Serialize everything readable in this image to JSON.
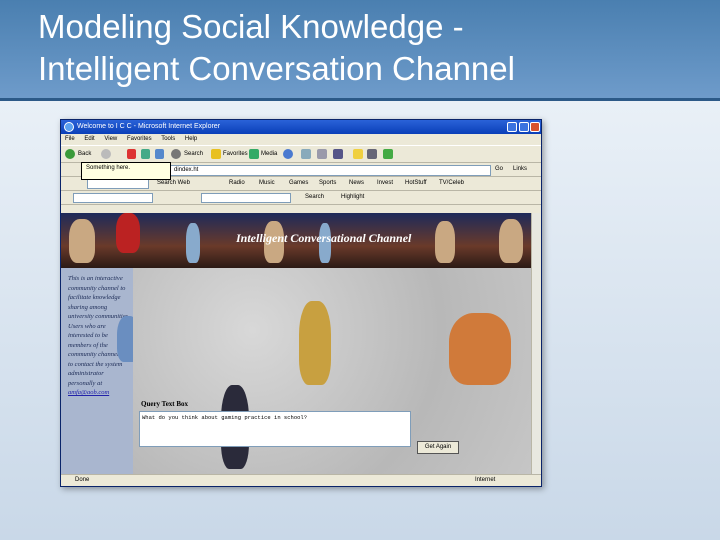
{
  "slide": {
    "title_line1": "Modeling Social Knowledge -",
    "title_line2": "Intelligent Conversation Channel"
  },
  "browser": {
    "window_title": "Welcome to I C C - Microsoft Internet Explorer",
    "menu": [
      "File",
      "Edit",
      "View",
      "Favorites",
      "Tools",
      "Help"
    ],
    "toolbar": {
      "back_label": "Back",
      "search_label": "Search",
      "favorites_label": "Favorites",
      "media_label": "Media"
    },
    "tooltip": "Something here.",
    "address_value": "dindex.ht",
    "go_label": "Go",
    "links_label": "Links",
    "links_bar_items": [
      "Radio",
      "Music",
      "Games",
      "Sports",
      "News",
      "Invest",
      "HotStuff",
      "TV/Celeb"
    ],
    "search_web_label": "Search Web",
    "search_label2": "Search",
    "highlight_label": "Highlight",
    "status_left": "Done",
    "status_right": "Internet"
  },
  "page": {
    "banner_title": "Intelligent Conversational Channel",
    "sidebar_text": "This is an interactive community channel to facilitate knowledge sharing among university communities. Users who are interested to be members of the community channel has to contact the system administrator personally at",
    "sidebar_email": "amfa@aob.com",
    "query_label": "Query Text Box",
    "query_value": "What do you think about gaming practice in school?",
    "ask_button": "Get Again"
  },
  "colors": {
    "slide_header": "#4a7fb0",
    "slide_background": "#dfe8f1",
    "banner": "#1e2a5a",
    "sidebar": "#a9b6cf"
  }
}
